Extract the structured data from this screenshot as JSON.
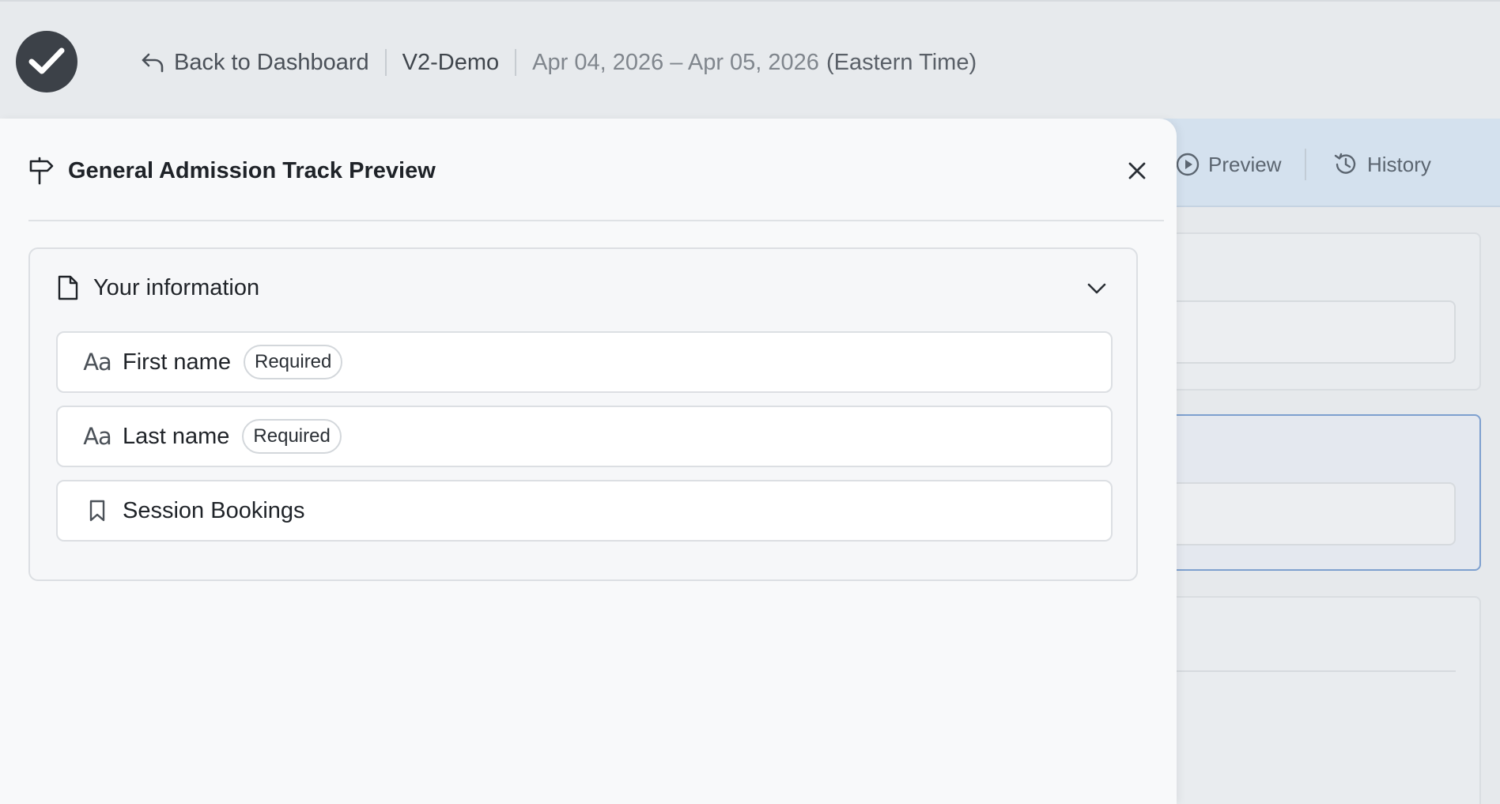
{
  "header": {
    "back_label": "Back to Dashboard",
    "event_name": "V2-Demo",
    "date_range": "Apr 04, 2026 – Apr 05, 2026",
    "timezone": "(Eastern Time)"
  },
  "background": {
    "tabs": [
      {
        "label": "Preview",
        "icon": "play-circle-icon"
      },
      {
        "label": "History",
        "icon": "history-icon"
      }
    ]
  },
  "drawer": {
    "title": "General Admission Track Preview",
    "title_icon": "signpost-icon",
    "section": {
      "title": "Your information",
      "icon": "document-icon",
      "expanded": true,
      "fields": [
        {
          "label": "First name",
          "icon": "Aa",
          "badge": "Required"
        },
        {
          "label": "Last name",
          "icon": "Aa",
          "badge": "Required"
        },
        {
          "label": "Session Bookings",
          "icon": "bookmark-icon"
        }
      ]
    }
  },
  "colors": {
    "accent_border": "#7ea0cf",
    "logo_bg": "#3c4148",
    "tab_bar_bg": "#d4e1ee"
  }
}
